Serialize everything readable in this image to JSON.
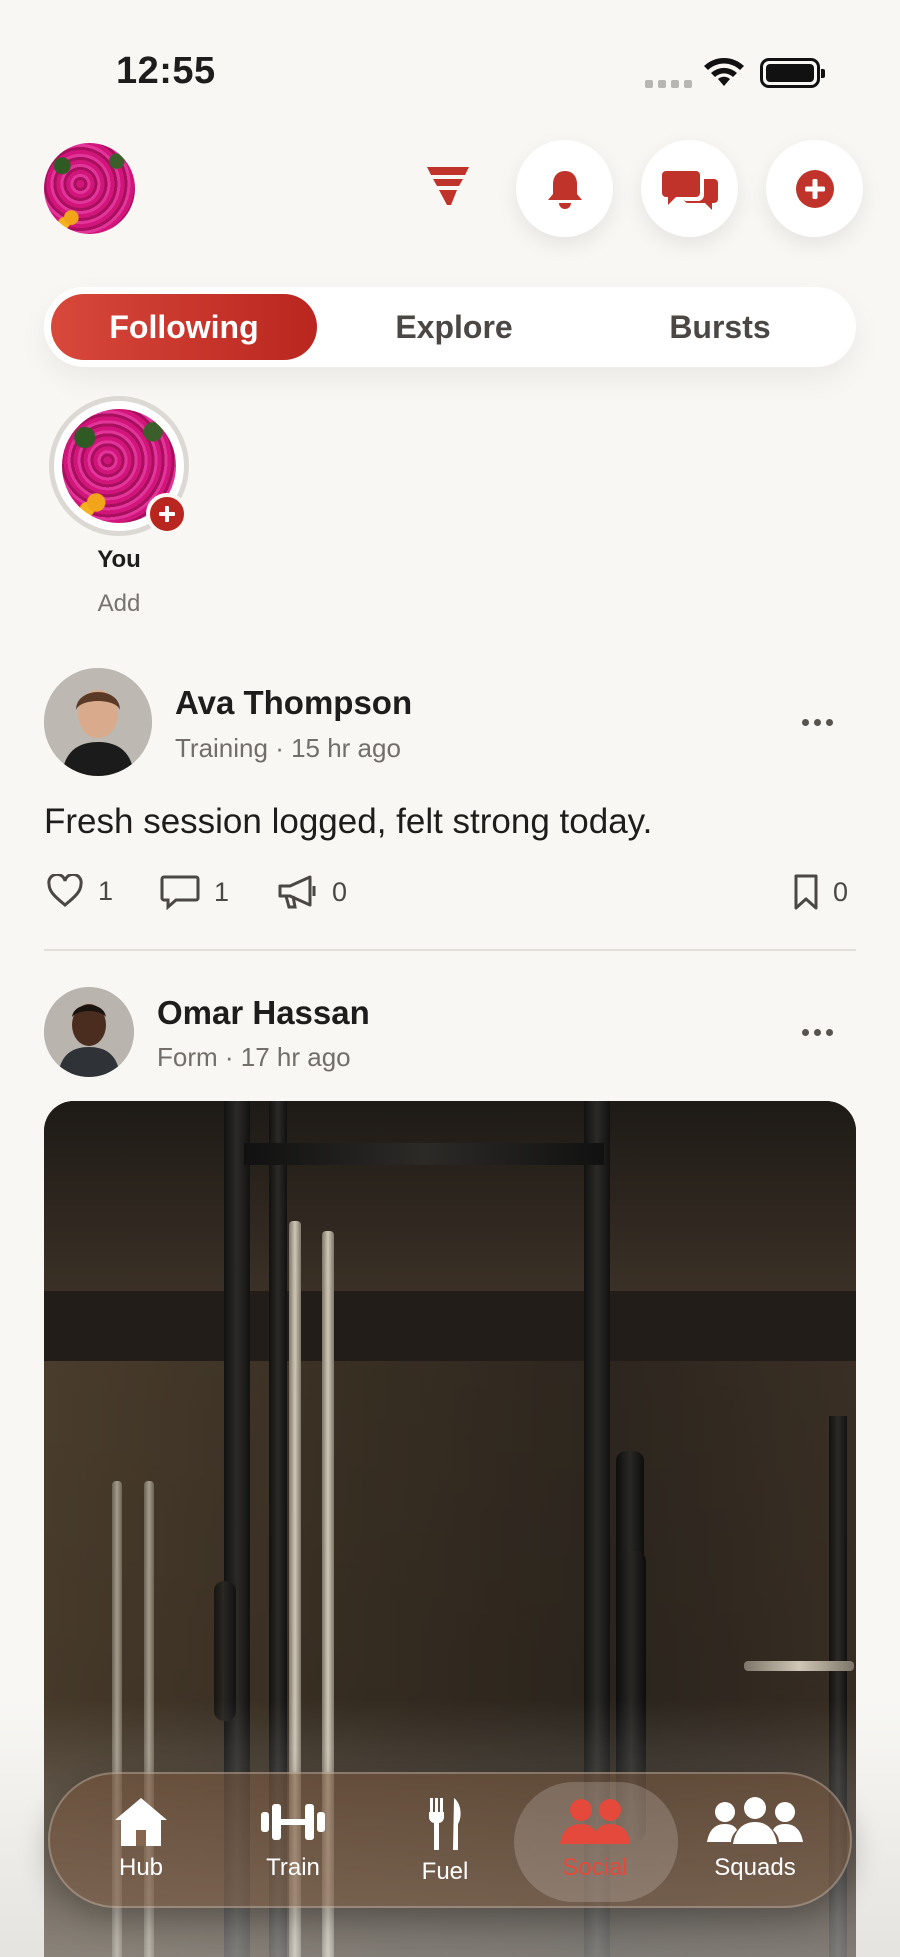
{
  "status_bar": {
    "time": "12:55"
  },
  "colors": {
    "accent": "#c0332a",
    "accent_dark": "#b8261f",
    "background": "#f8f7f4"
  },
  "header": {
    "icons": [
      "brand-logo",
      "bell-icon",
      "chat-bubbles-icon",
      "plus-circle-icon"
    ]
  },
  "tabs": [
    {
      "label": "Following",
      "active": true
    },
    {
      "label": "Explore",
      "active": false
    },
    {
      "label": "Bursts",
      "active": false
    }
  ],
  "stories": [
    {
      "name": "You",
      "sub": "Add"
    }
  ],
  "posts": [
    {
      "author": "Ava Thompson",
      "meta": "Training · 15 hr ago",
      "text": "Fresh session logged, felt strong today.",
      "likes": "1",
      "comments": "1",
      "shares": "0",
      "saves": "0"
    },
    {
      "author": "Omar Hassan",
      "meta": "Form · 17 hr ago"
    }
  ],
  "bottom_nav": [
    {
      "label": "Hub",
      "icon": "home-icon",
      "active": false
    },
    {
      "label": "Train",
      "icon": "dumbbell-icon",
      "active": false
    },
    {
      "label": "Fuel",
      "icon": "fork-knife-icon",
      "active": false
    },
    {
      "label": "Social",
      "icon": "people-icon",
      "active": true
    },
    {
      "label": "Squads",
      "icon": "group-icon",
      "active": false
    }
  ]
}
